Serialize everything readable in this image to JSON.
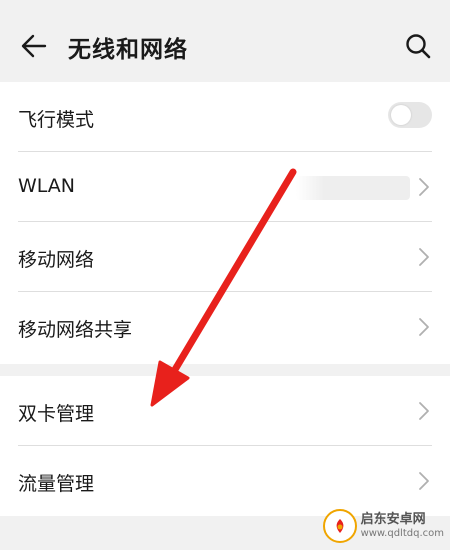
{
  "header": {
    "title": "无线和网络",
    "back_icon": "arrow-left-icon",
    "search_icon": "search-icon"
  },
  "sections": [
    {
      "items": [
        {
          "label": "飞行模式",
          "control": "toggle",
          "toggle_on": false
        },
        {
          "label": "WLAN",
          "control": "chevron",
          "value_obscured": true
        },
        {
          "label": "移动网络",
          "control": "chevron"
        },
        {
          "label": "移动网络共享",
          "control": "chevron"
        }
      ]
    },
    {
      "items": [
        {
          "label": "双卡管理",
          "control": "chevron"
        },
        {
          "label": "流量管理",
          "control": "chevron"
        }
      ]
    }
  ],
  "annotation": {
    "type": "arrow",
    "color": "#e8211c",
    "points_to": "双卡管理"
  },
  "watermark": {
    "name": "启东安卓网",
    "url": "www.qdltdq.com"
  },
  "colors": {
    "background": "#f1f1f1",
    "card": "#ffffff",
    "divider": "#dedede",
    "text": "#1a1a1a",
    "chevron": "#b0b0b0",
    "toggle_track_off": "#e6e6e6"
  }
}
